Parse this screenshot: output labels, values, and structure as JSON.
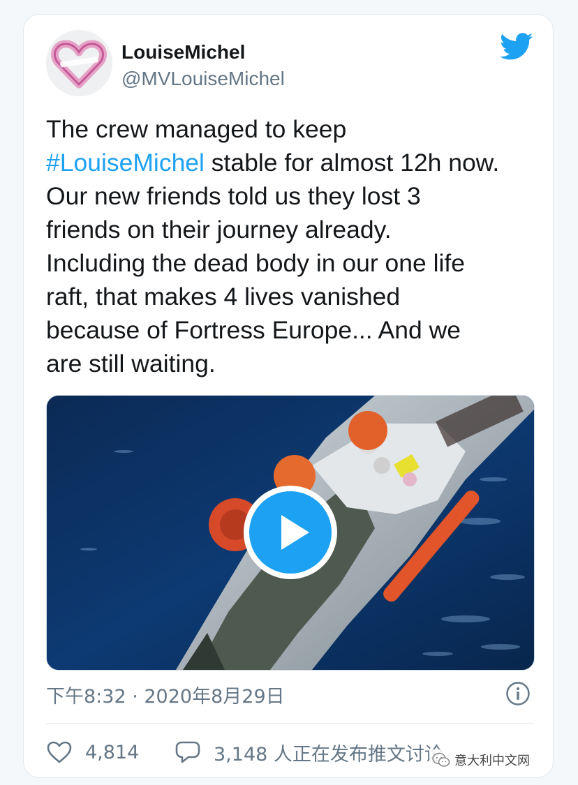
{
  "tweet": {
    "display_name": "LouiseMichel",
    "handle": "@MVLouiseMichel",
    "text_before_hashtag": "The crew managed to keep\n",
    "hashtag": "#LouiseMichel",
    "text_after_hashtag": " stable for almost 12h now.\nOur new friends told us they lost 3\nfriends on their journey already.\nIncluding the dead body in our one life\nraft, that makes 4 lives vanished\nbecause of Fortress Europe... And we\nare still waiting.",
    "timestamp": "下午8:32 · 2020年8月29日"
  },
  "actions": {
    "likes": "4,814",
    "replies": "3,148 人正在发布推文讨论"
  },
  "watermark": {
    "text": "意大利中文网"
  },
  "icons": {
    "twitter": "twitter-bird-icon",
    "play": "play-icon",
    "info": "info-icon",
    "like": "heart-icon",
    "reply": "speech-bubble-icon",
    "wechat": "wechat-icon"
  },
  "colors": {
    "accent": "#1da1f2",
    "text": "#14171a",
    "secondary": "#657786"
  }
}
